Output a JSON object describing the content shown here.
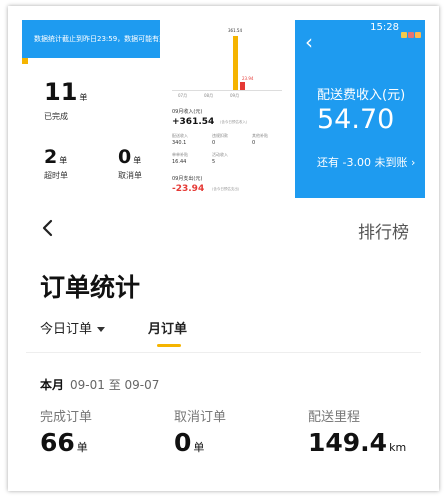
{
  "collage": {
    "left_panel": {
      "banner": "数据统计截止到昨日23:59，数据可能有延迟",
      "completed": {
        "value": "11",
        "unit": "单",
        "label": "已完成"
      },
      "overtime": {
        "value": "2",
        "unit": "单",
        "label": "超时单"
      },
      "cancelled": {
        "value": "0",
        "unit": "单",
        "label": "取消单"
      }
    },
    "middle_panel": {
      "chart_data": {
        "type": "bar",
        "categories": [
          "",
          "",
          "",
          "09月"
        ],
        "values": [
          0.0,
          0.0,
          16.44,
          361.54
        ],
        "top_label": "361.54",
        "side_label": "23.94"
      },
      "ticks": [
        "07月",
        "08月",
        "09月"
      ],
      "income_title": "09月收入(元)",
      "income_value": "+361.54",
      "income_note": "(含今日预估收入)",
      "cells": [
        {
          "label": "配送收入",
          "value": "340.1"
        },
        {
          "label": "违规扣款",
          "value": "0"
        },
        {
          "label": "其他补贴",
          "value": "0"
        },
        {
          "label": "单单补贴",
          "value": "16.44"
        },
        {
          "label": "活动收入",
          "value": "5"
        }
      ],
      "expense_title": "09月支出(元)",
      "expense_value": "-23.94",
      "expense_note": "(含今日预估支出)"
    },
    "right_panel": {
      "time": "15:28",
      "title": "配送费收入(元)",
      "amount": "54.70",
      "pending": "还有 -3.00 未到账 ›"
    }
  },
  "header": {
    "rank_label": "排行榜"
  },
  "page_title": "订单统计",
  "tabs": {
    "today": "今日订单",
    "month": "月订单"
  },
  "summary": {
    "period_label": "本月",
    "range": "09-01 至 09-07",
    "completed": {
      "label": "完成订单",
      "value": "66",
      "unit": "单"
    },
    "cancelled": {
      "label": "取消订单",
      "value": "0",
      "unit": "单"
    },
    "distance": {
      "label": "配送里程",
      "value": "149.4",
      "unit": "km"
    }
  },
  "colors": {
    "brand_blue": "#1e9bf0",
    "accent_yellow": "#f5b400",
    "negative_red": "#e53935"
  }
}
